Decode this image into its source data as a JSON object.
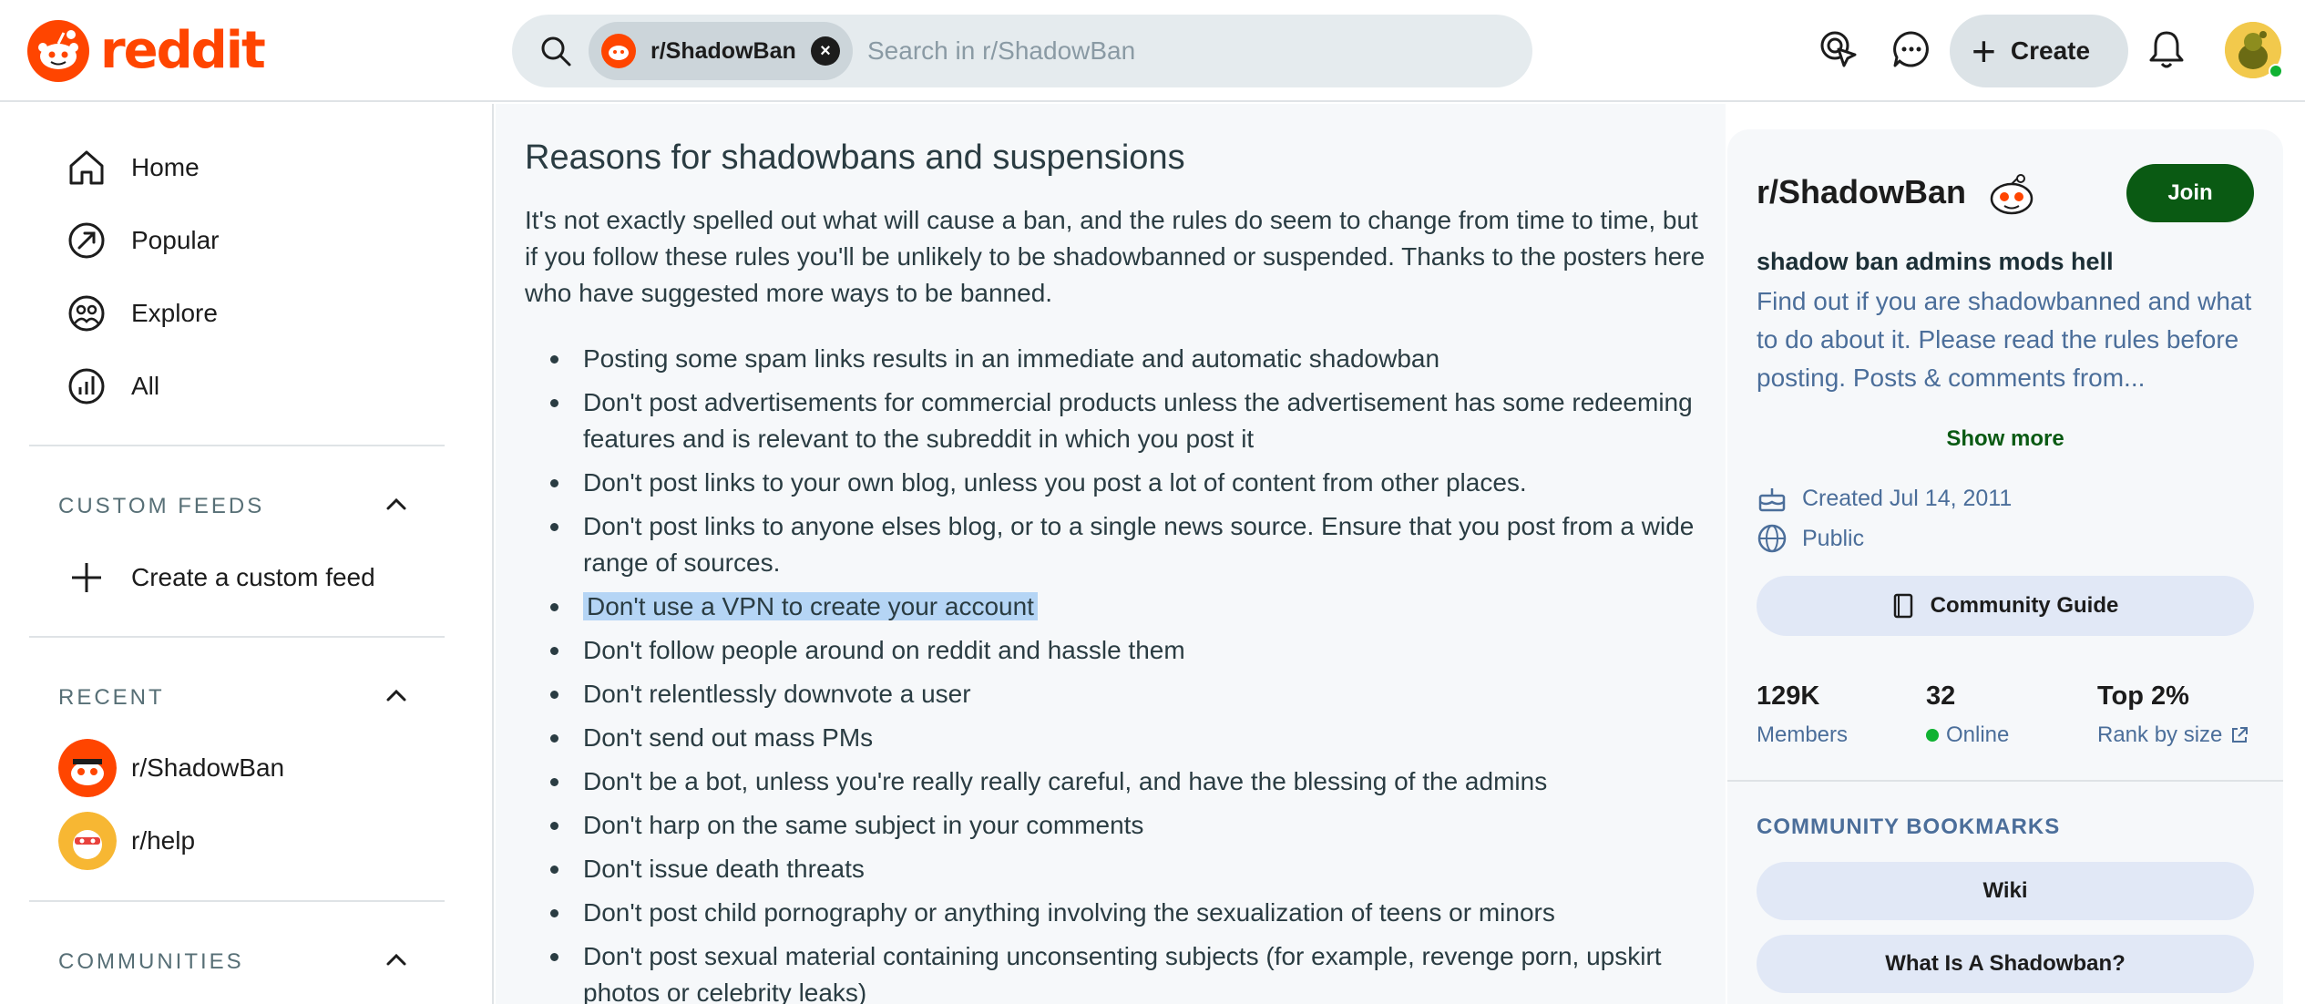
{
  "header": {
    "logo_text": "reddit",
    "search": {
      "chip_label": "r/ShadowBan",
      "chip_close": "×",
      "placeholder": "Search in r/ShadowBan"
    },
    "create_label": "Create",
    "icons": [
      "advertise-icon",
      "chat-icon",
      "plus-icon",
      "bell-icon"
    ]
  },
  "sidebar": {
    "nav": [
      {
        "label": "Home",
        "icon": "home-icon"
      },
      {
        "label": "Popular",
        "icon": "popular-icon"
      },
      {
        "label": "Explore",
        "icon": "explore-icon"
      },
      {
        "label": "All",
        "icon": "all-icon"
      }
    ],
    "custom_feeds": {
      "heading": "CUSTOM FEEDS",
      "create_label": "Create a custom feed"
    },
    "recent": {
      "heading": "RECENT",
      "items": [
        {
          "label": "r/ShadowBan"
        },
        {
          "label": "r/help"
        }
      ]
    },
    "communities": {
      "heading": "COMMUNITIES"
    }
  },
  "wiki": {
    "title": "Reasons for shadowbans and suspensions",
    "intro": "It's not exactly spelled out what will cause a ban, and the rules do seem to change from time to time, but if you follow these rules you'll be unlikely to be shadowbanned or suspended. Thanks to the posters here who have suggested more ways to be banned.",
    "rules": [
      "Posting some spam links results in an immediate and automatic shadowban",
      "Don't post advertisements for commercial products unless the advertisement has some redeeming features and is relevant to the subreddit in which you post it",
      "Don't post links to your own blog, unless you post a lot of content from other places.",
      "Don't post links to anyone elses blog, or to a single news source. Ensure that you post from a wide range of sources.",
      "Don't use a VPN to create your account",
      "Don't follow people around on reddit and hassle them",
      "Don't relentlessly downvote a user",
      "Don't send out mass PMs",
      "Don't be a bot, unless you're really really careful, and have the blessing of the admins",
      "Don't harp on the same subject in your comments",
      "Don't issue death threats",
      "Don't post child pornography or anything involving the sexualization of teens or minors",
      "Don't post sexual material containing unconsenting subjects (for example, revenge porn, upskirt photos or celebrity leaks)"
    ]
  },
  "community": {
    "name": "r/ShadowBan",
    "join_label": "Join",
    "tagline": "shadow ban admins mods hell",
    "description": "Find out if you are shadowbanned and what to do about it. Please read the rules before posting. Posts & comments from...",
    "show_more": "Show more",
    "created": "Created Jul 14, 2011",
    "visibility": "Public",
    "guide_label": "Community Guide",
    "stats": {
      "members_value": "129K",
      "members_label": "Members",
      "online_value": "32",
      "online_label": "Online",
      "rank_value": "Top 2%",
      "rank_label": "Rank by size"
    },
    "bookmarks_heading": "COMMUNITY BOOKMARKS",
    "bookmarks": [
      "Wiki",
      "What Is A Shadowban?"
    ]
  },
  "colors": {
    "brand": "#ff4500",
    "join": "#0a5a13",
    "link_text": "#4b6e9a",
    "highlight": "#b5d5f5",
    "online": "#10b232"
  }
}
